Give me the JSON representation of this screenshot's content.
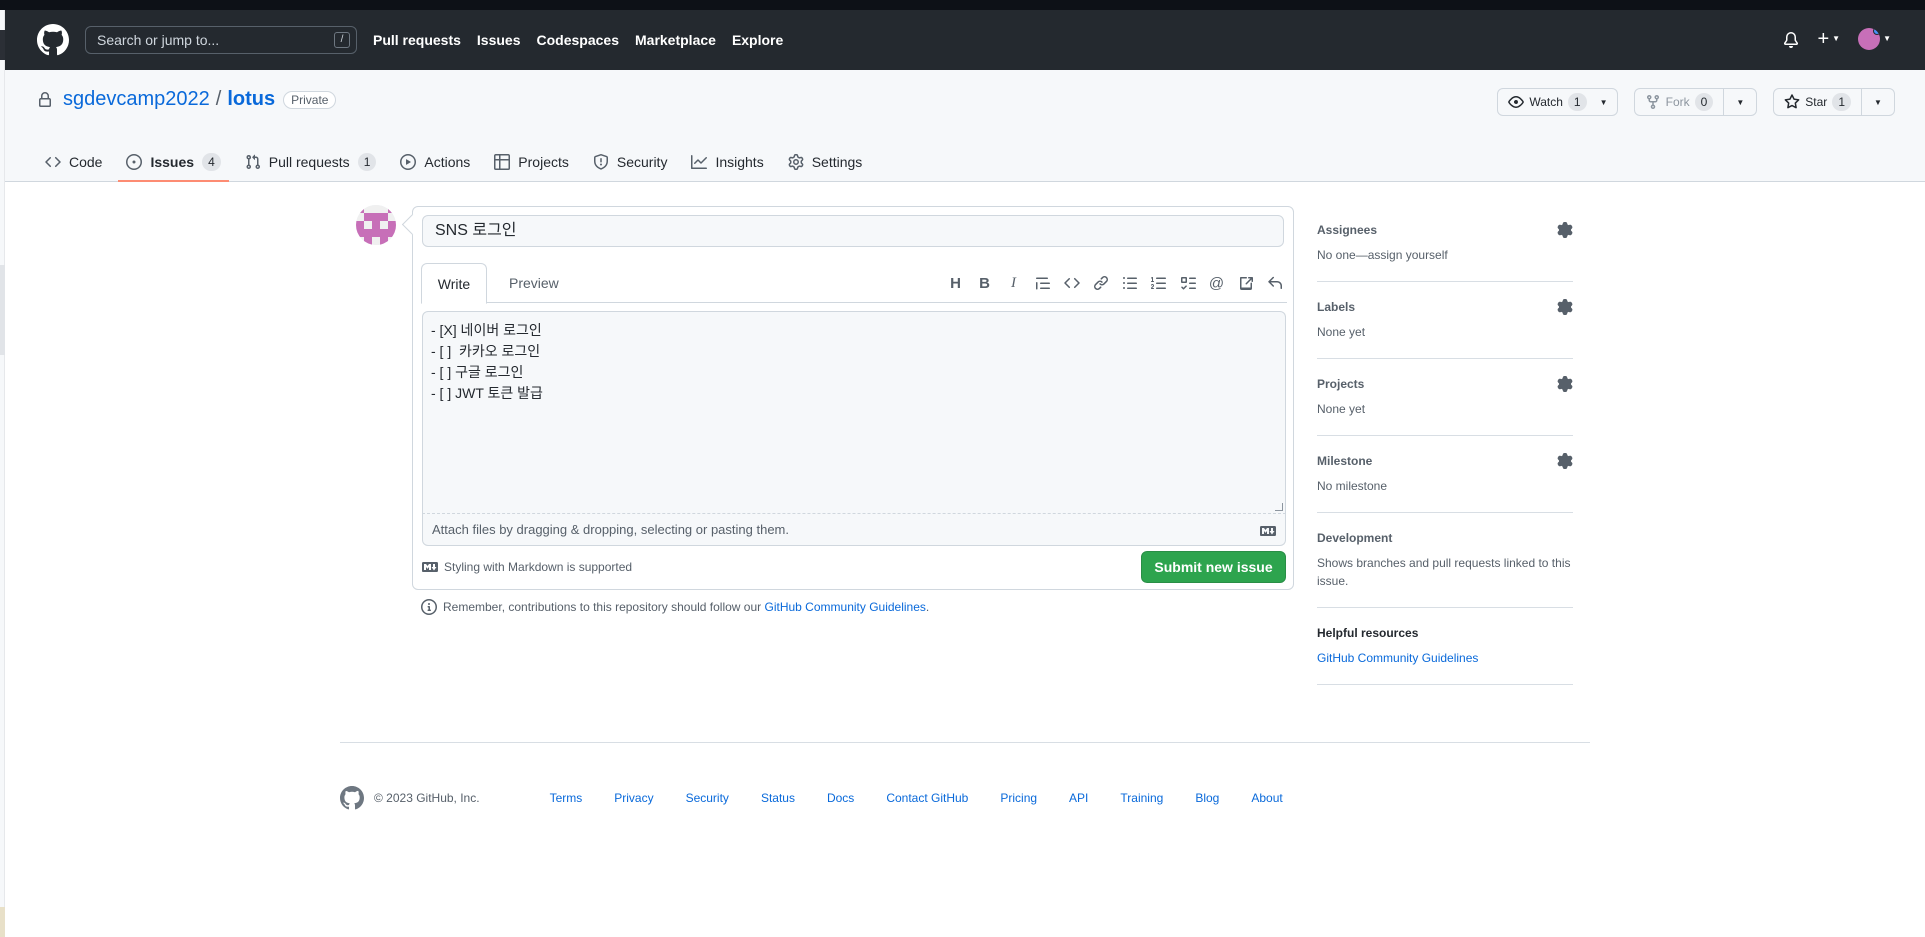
{
  "header": {
    "search_placeholder": "Search or jump to...",
    "search_shortcut": "/",
    "nav": [
      "Pull requests",
      "Issues",
      "Codespaces",
      "Marketplace",
      "Explore"
    ],
    "plus_label": "+"
  },
  "repo": {
    "owner": "sgdevcamp2022",
    "separator": "/",
    "name": "lotus",
    "visibility": "Private",
    "watch": {
      "label": "Watch",
      "count": "1"
    },
    "fork": {
      "label": "Fork",
      "count": "0"
    },
    "star": {
      "label": "Star",
      "count": "1"
    }
  },
  "tabs": [
    {
      "label": "Code"
    },
    {
      "label": "Issues",
      "count": "4"
    },
    {
      "label": "Pull requests",
      "count": "1"
    },
    {
      "label": "Actions"
    },
    {
      "label": "Projects"
    },
    {
      "label": "Security"
    },
    {
      "label": "Insights"
    },
    {
      "label": "Settings"
    }
  ],
  "issue": {
    "title_value": "SNS 로그인",
    "write_tab": "Write",
    "preview_tab": "Preview",
    "body_lines": [
      "- [X] 네이버 로그인",
      "- [ ]  카카오 로그인",
      "- [ ] 구글 로그인",
      "- [ ] JWT 토큰 발급"
    ],
    "attach_text": "Attach files by dragging & dropping, selecting or pasting them.",
    "markdown_note": "Styling with Markdown is supported",
    "submit_label": "Submit new issue",
    "guidelines_prefix": "Remember, contributions to this repository should follow our",
    "guidelines_link": "GitHub Community Guidelines",
    "guidelines_suffix": "."
  },
  "sidebar": {
    "assignees": {
      "title": "Assignees",
      "value": "No one—assign yourself"
    },
    "labels": {
      "title": "Labels",
      "value": "None yet"
    },
    "projects": {
      "title": "Projects",
      "value": "None yet"
    },
    "milestone": {
      "title": "Milestone",
      "value": "No milestone"
    },
    "development": {
      "title": "Development",
      "value": "Shows branches and pull requests linked to this issue."
    },
    "helpful": {
      "title": "Helpful resources",
      "value": "GitHub Community Guidelines"
    }
  },
  "footer": {
    "copyright": "© 2023 GitHub, Inc.",
    "links": [
      "Terms",
      "Privacy",
      "Security",
      "Status",
      "Docs",
      "Contact GitHub",
      "Pricing",
      "API",
      "Training",
      "Blog",
      "About"
    ]
  },
  "colors": {
    "header_bg": "#24292f",
    "link": "#0969da",
    "submit": "#2da44e",
    "tab_underline": "#fd8c73"
  }
}
